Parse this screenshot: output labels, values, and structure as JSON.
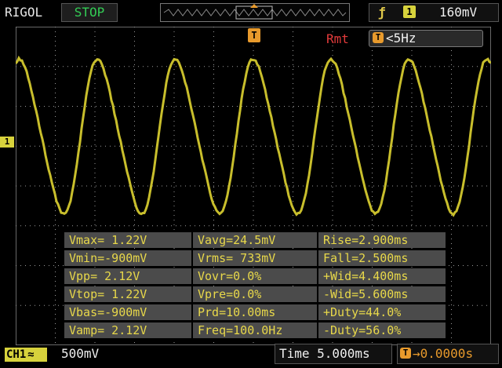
{
  "header": {
    "brand": "RIGOL",
    "run_state": "STOP",
    "trigger_edge_icon": "rising-edge-icon",
    "trigger_channel": "1",
    "trigger_level": "160mV"
  },
  "overlay": {
    "remote": "Rmt",
    "trigger_marker": "T",
    "freq_icon": "T",
    "frequency": "<5Hz",
    "channel_marker": "1"
  },
  "measurements": [
    [
      "Vmax= 1.22V",
      "Vavg=24.5mV",
      "Rise=2.900ms"
    ],
    [
      "Vmin=-900mV",
      "Vrms= 733mV",
      "Fall=2.500ms"
    ],
    [
      "Vpp= 2.12V",
      "Vovr=0.0%",
      "+Wid=4.400ms"
    ],
    [
      "Vtop= 1.22V",
      "Vpre=0.0%",
      "-Wid=5.600ms"
    ],
    [
      "Vbas=-900mV",
      "Prd=10.00ms",
      "+Duty=44.0%"
    ],
    [
      "Vamp= 2.12V",
      "Freq=100.0Hz",
      "-Duty=56.0%"
    ]
  ],
  "footer": {
    "channel": "CH1",
    "coupling_icon": "ac-coupling-icon",
    "volts_per_div": "500mV",
    "timebase": "Time 5.000ms",
    "offset_icon": "T",
    "trigger_offset": "0.0000s"
  },
  "colors": {
    "trace": "#c8be2c",
    "accent": "#e89a2c",
    "remote": "#e23a3a",
    "run_state": "#33cc55"
  }
}
